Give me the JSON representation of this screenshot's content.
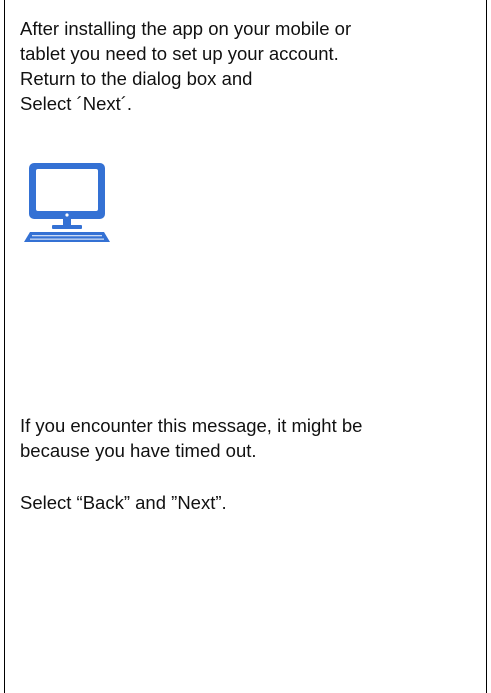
{
  "instructions": {
    "setup_paragraph": [
      "After installing the app on your mobile or",
      "tablet you need to set up your account.",
      "Return to the dialog box and",
      "Select ´Next´."
    ],
    "timeout_paragraph": [
      "If you encounter this message, it might be",
      "because you have timed out."
    ],
    "action_paragraph": [
      "Select “Back” and ”Next”."
    ]
  },
  "icon": {
    "name": "desktop-computer-icon",
    "color": "#3471d4"
  }
}
